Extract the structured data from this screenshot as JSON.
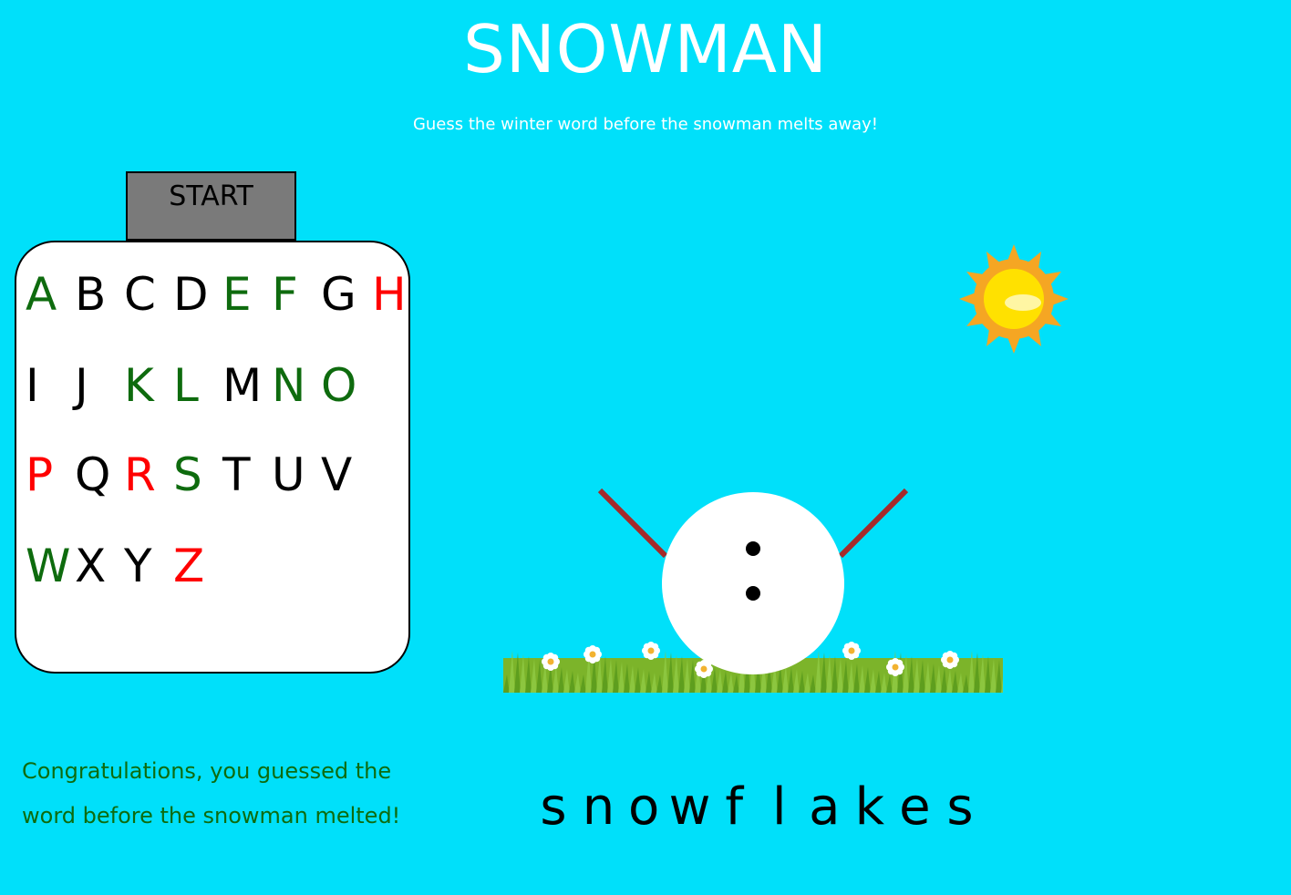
{
  "title": "SNOWMAN",
  "subtitle": "Guess the winter word before the snowman melts away!",
  "start_button": {
    "label": "START"
  },
  "letters": [
    {
      "char": "A",
      "state": "correct"
    },
    {
      "char": "B",
      "state": "unused"
    },
    {
      "char": "C",
      "state": "unused"
    },
    {
      "char": "D",
      "state": "unused"
    },
    {
      "char": "E",
      "state": "correct"
    },
    {
      "char": "F",
      "state": "correct"
    },
    {
      "char": "G",
      "state": "unused"
    },
    {
      "char": "H",
      "state": "wrong"
    },
    {
      "char": "I",
      "state": "unused"
    },
    {
      "char": "J",
      "state": "unused"
    },
    {
      "char": "K",
      "state": "correct"
    },
    {
      "char": "L",
      "state": "correct"
    },
    {
      "char": "M",
      "state": "unused"
    },
    {
      "char": "N",
      "state": "correct"
    },
    {
      "char": "O",
      "state": "correct"
    },
    {
      "char": "P",
      "state": "wrong"
    },
    {
      "char": "Q",
      "state": "unused"
    },
    {
      "char": "R",
      "state": "wrong"
    },
    {
      "char": "S",
      "state": "correct"
    },
    {
      "char": "T",
      "state": "unused"
    },
    {
      "char": "U",
      "state": "unused"
    },
    {
      "char": "V",
      "state": "unused"
    },
    {
      "char": "W",
      "state": "correct"
    },
    {
      "char": "X",
      "state": "unused"
    },
    {
      "char": "Y",
      "state": "unused"
    },
    {
      "char": "Z",
      "state": "wrong"
    }
  ],
  "answer_letters": [
    "s",
    "n",
    "o",
    "w",
    "f",
    "l",
    "a",
    "k",
    "e",
    "s"
  ],
  "message": "Congratulations, you guessed the word before the snowman melted!",
  "icons": {
    "sun": "sun-icon",
    "grass": "grass-flowers",
    "snowman": "snowman-figure"
  },
  "colors": {
    "background": "#00e0fa",
    "title": "#ffffff",
    "start_button_bg": "#7a7a7a",
    "panel_bg": "#ffffff",
    "letter_unused": "#000000",
    "letter_correct": "#0e6b0e",
    "letter_wrong": "#ff0000",
    "message": "#0e6b0e",
    "snowman_arm": "#a52a2a",
    "sun_outer": "#f5a623",
    "sun_inner": "#ffe100"
  }
}
